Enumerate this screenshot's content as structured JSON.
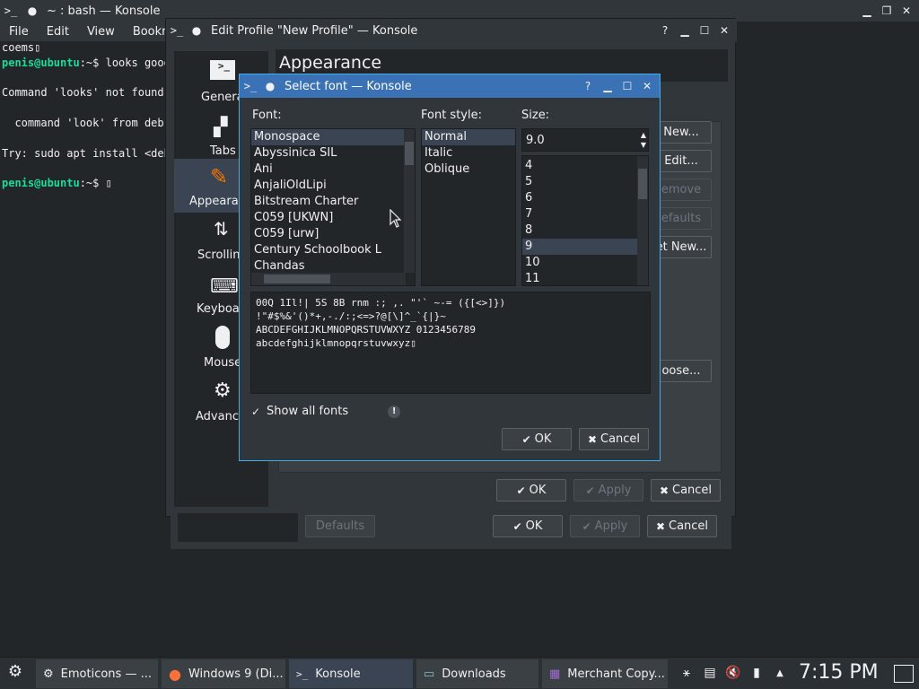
{
  "konsole": {
    "title": "~ : bash — Konsole",
    "menu": [
      "File",
      "Edit",
      "View",
      "Bookmar"
    ],
    "lines": [
      {
        "text": "coems▯"
      },
      {
        "user": "penis@ubuntu",
        "rest": ":~$ looks good"
      },
      {
        "text": ""
      },
      {
        "text": "Command 'looks' not found,"
      },
      {
        "text": ""
      },
      {
        "text": "  command 'look' from deb"
      },
      {
        "text": ""
      },
      {
        "text": "Try: sudo apt install <deb"
      },
      {
        "text": ""
      },
      {
        "user": "penis@ubuntu",
        "rest": ":~$ ▯"
      }
    ]
  },
  "profile": {
    "title": "Edit Profile \"New Profile\" — Konsole",
    "page_title": "Appearance",
    "sidebar": [
      "General",
      "Tabs",
      "Appearar",
      "Scrollin",
      "Keyboar",
      "Mouse",
      "Advance"
    ],
    "side_buttons": [
      "New...",
      "Edit...",
      "emove",
      "efaults",
      "et New...",
      "oose..."
    ],
    "ok": "OK",
    "apply": "Apply",
    "cancel": "Cancel",
    "defaults": "Defaults"
  },
  "font_dialog": {
    "title": "Select font — Konsole",
    "font_label": "Font:",
    "style_label": "Font style:",
    "size_label": "Size:",
    "fonts": [
      "Monospace",
      "Abyssinica SIL",
      "Ani",
      "AnjaliOldLipi",
      "Bitstream Charter",
      "C059 [UKWN]",
      "C059 [urw]",
      "Century Schoolbook L",
      "Chandas"
    ],
    "styles": [
      "Normal",
      "Italic",
      "Oblique"
    ],
    "size_value": "9.0",
    "sizes": [
      "4",
      "5",
      "6",
      "7",
      "8",
      "9",
      "10",
      "11"
    ],
    "preview": "00Q 1Il!| 5S 8B rnm :; ,. \"'` ~-= ({[<>]})\n!\"#$%&'()*+,-./:;<=>?@[\\]^_`{|}~\nABCDEFGHIJKLMNOPQRSTUVWXYZ 0123456789\nabcdefghijklmnopqrstuvwxyz▯",
    "show_all_fonts": "Show all fonts",
    "ok": "OK",
    "cancel": "Cancel"
  },
  "taskbar": {
    "tasks": [
      "Emoticons — ...",
      "Windows 9 (Di...",
      "Konsole",
      "Downloads",
      "Merchant Copy..."
    ],
    "clock": "7:15 PM"
  }
}
